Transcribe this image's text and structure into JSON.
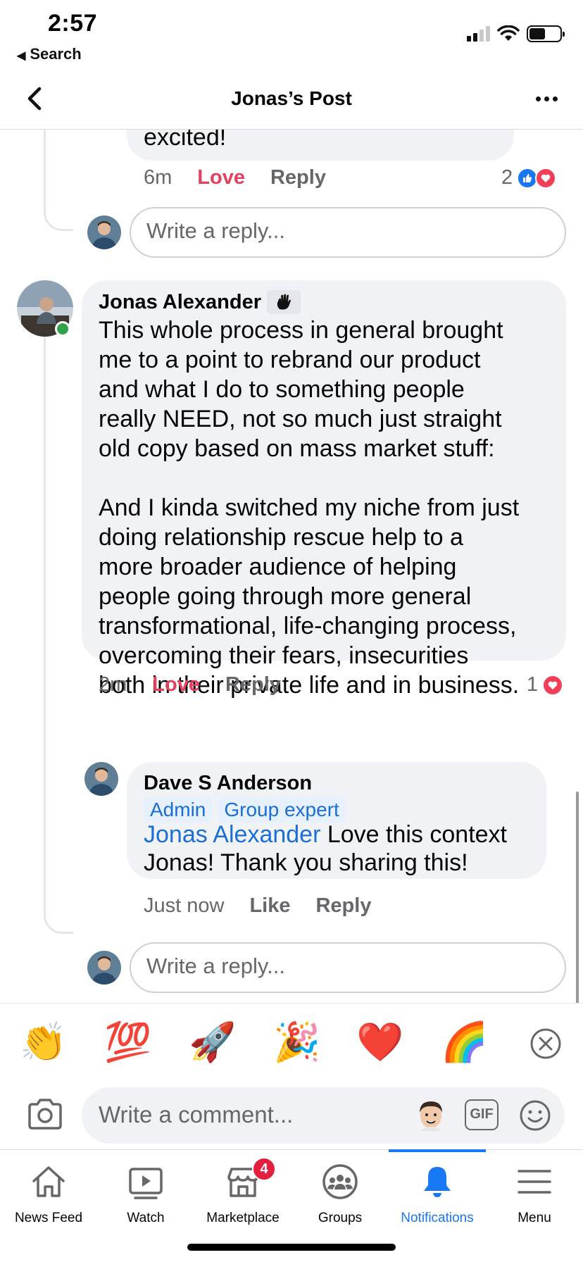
{
  "status_bar": {
    "time": "2:57",
    "back_label": "Search"
  },
  "header": {
    "title": "Jonas’s Post"
  },
  "prev_comment": {
    "text_tail": "excited!",
    "time": "6m",
    "love": "Love",
    "reply": "Reply",
    "reaction_count": "2"
  },
  "reply_placeholder": "Write a reply...",
  "main_comment": {
    "author": "Jonas Alexander",
    "badge_icon": "waving-hand-icon",
    "paragraph1": [
      "This whole process in general brought",
      "me to a point to rebrand our product",
      "and what I do to something people",
      "really NEED, not so much just straight",
      "old copy based on mass market stuff:"
    ],
    "paragraph2": [
      "And I kinda switched my niche from just",
      "doing relationship rescue help to a",
      "more broader audience of helping",
      "people going through more general",
      "transformational, life-changing process,",
      "overcoming their fears, insecurities",
      "both in their private life and in business."
    ],
    "time": "2m",
    "love": "Love",
    "reply": "Reply",
    "reaction_count": "1"
  },
  "reply_comment": {
    "author": "Dave S Anderson",
    "tags": [
      "Admin",
      "Group expert"
    ],
    "mention": "Jonas Alexander",
    "text_line1": " Love this context",
    "text_line2": "Jonas! Thank you sharing this!",
    "time": "Just now",
    "like": "Like",
    "reply": "Reply"
  },
  "emoji_bar": {
    "emojis": [
      "👏",
      "💯",
      "🚀",
      "🎉",
      "❤️",
      "🌈"
    ]
  },
  "composer": {
    "placeholder": "Write a comment...",
    "gif_label": "GIF"
  },
  "tabs": [
    {
      "label": "News Feed",
      "icon": "home-icon"
    },
    {
      "label": "Watch",
      "icon": "watch-icon"
    },
    {
      "label": "Marketplace",
      "icon": "marketplace-icon",
      "badge": "4"
    },
    {
      "label": "Groups",
      "icon": "groups-icon"
    },
    {
      "label": "Notifications",
      "icon": "bell-icon",
      "active": true
    },
    {
      "label": "Menu",
      "icon": "menu-icon"
    }
  ],
  "colors": {
    "accent": "#1877f2",
    "love": "#e4405f",
    "online": "#31a24c",
    "badge": "#e41e3f"
  }
}
